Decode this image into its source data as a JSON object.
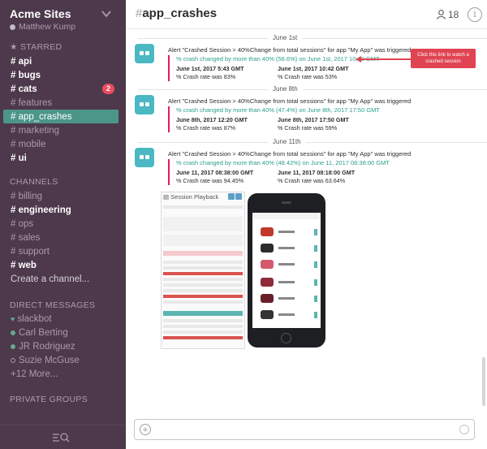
{
  "sidebar": {
    "team_name": "Acme Sites",
    "user_name": "Matthew Kump",
    "starred_title": "STARRED",
    "starred": [
      {
        "label": "# api"
      },
      {
        "label": "# bugs"
      },
      {
        "label": "# cats",
        "badge": "2"
      },
      {
        "label": "# features"
      },
      {
        "label": "# app_crashes"
      },
      {
        "label": "# marketing"
      },
      {
        "label": "# mobile"
      },
      {
        "label": "# ui"
      }
    ],
    "channels_title": "CHANNELS",
    "channels": [
      {
        "label": "# billing"
      },
      {
        "label": "# engineering"
      },
      {
        "label": "# ops"
      },
      {
        "label": "# sales"
      },
      {
        "label": "# support"
      },
      {
        "label": "# web"
      },
      {
        "label": "Create a channel..."
      }
    ],
    "dm_title": "DIRECT MESSAGES",
    "dms": [
      {
        "label": "slackbot"
      },
      {
        "label": "Carl Berting"
      },
      {
        "label": "JR Rodriguez"
      },
      {
        "label": "Suzie McGuse"
      },
      {
        "label": "+12 More..."
      }
    ],
    "private_title": "PRIVATE GROUPS"
  },
  "header": {
    "hash": "#",
    "channel": "app_crashes",
    "member_count": "18",
    "info_glyph": "i"
  },
  "messages": [
    {
      "date": "June 1st",
      "alert": "Alert \"Crashed Session > 40%Change from total sessions\" for app \"My App\" was triggered",
      "link": "% crash changed by more than 40% (56.6%) on June 1st, 2017 10:42 GMT",
      "left_date": "June 1st, 2017 5:43 GMT",
      "left_rate": "% Crash rate was 83%",
      "right_date": "June 1st, 2017 10:42 GMT",
      "right_rate": "% Crash rate was 53%"
    },
    {
      "date": "June 8th",
      "alert": "Alert \"Crashed Session > 40%Change from total sessions\" for app \"My App\" was triggered",
      "link": "% crash changed by more than 40% (47.4%) on June 8th, 2017 17:50 GMT",
      "left_date": "June 8th, 2017 12:20 GMT",
      "left_rate": "% Crash rate was 87%",
      "right_date": "June 8th, 2017 17:50 GMT",
      "right_rate": "% Crash rate was 59%"
    },
    {
      "date": "June 11th",
      "alert": "Alert \"Crashed Session > 40%Change from total sessions\" for app \"My App\" was triggered",
      "link": "% crash changed by more than 40% (48.42%) on June 11, 2017 08:38:00 GMT",
      "left_date": "June 11, 2017 08:38:00 GMT",
      "left_rate": "% Crash rate was 94.45%",
      "right_date": "June 11, 2017 08:18:00 GMT",
      "right_rate": "% Crash rate was 63.64%"
    }
  ],
  "callout": "Click this link to watch a crashed session",
  "session_playback": {
    "title": "Session Playback"
  },
  "composer": {
    "plus_glyph": "+"
  },
  "icons": {
    "chevron": "chevron-down-icon",
    "members": "person-icon",
    "info": "info-icon",
    "filter": "filter-search-icon"
  },
  "colors": {
    "sidebar_bg": "#4d394b",
    "active": "#4c9689",
    "accent_link": "#2a9e8b",
    "attachment_bar": "#e01e5a",
    "callout": "#e04352",
    "bot_avatar": "#4bb8c4"
  }
}
